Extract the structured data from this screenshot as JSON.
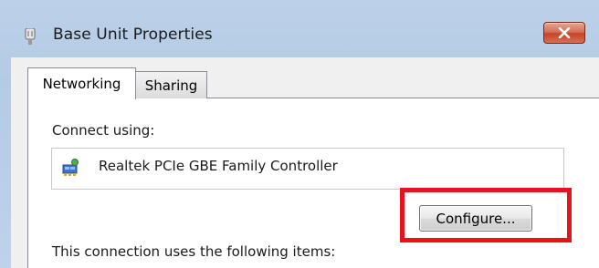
{
  "window": {
    "title": "Base Unit Properties",
    "icon": "network-adapter-icon",
    "close_icon": "close-icon"
  },
  "tabs": [
    {
      "label": "Networking",
      "selected": true
    },
    {
      "label": "Sharing",
      "selected": false
    }
  ],
  "networking": {
    "connect_using_label": "Connect using:",
    "adapter_name": "Realtek PCIe GBE Family Controller",
    "adapter_icon": "network-card-icon",
    "configure_button": "Configure...",
    "items_label": "This connection uses the following items:"
  },
  "colors": {
    "highlight": "#e8121c",
    "titlebar": "#b9cfe7",
    "close_button": "#c5432a"
  }
}
